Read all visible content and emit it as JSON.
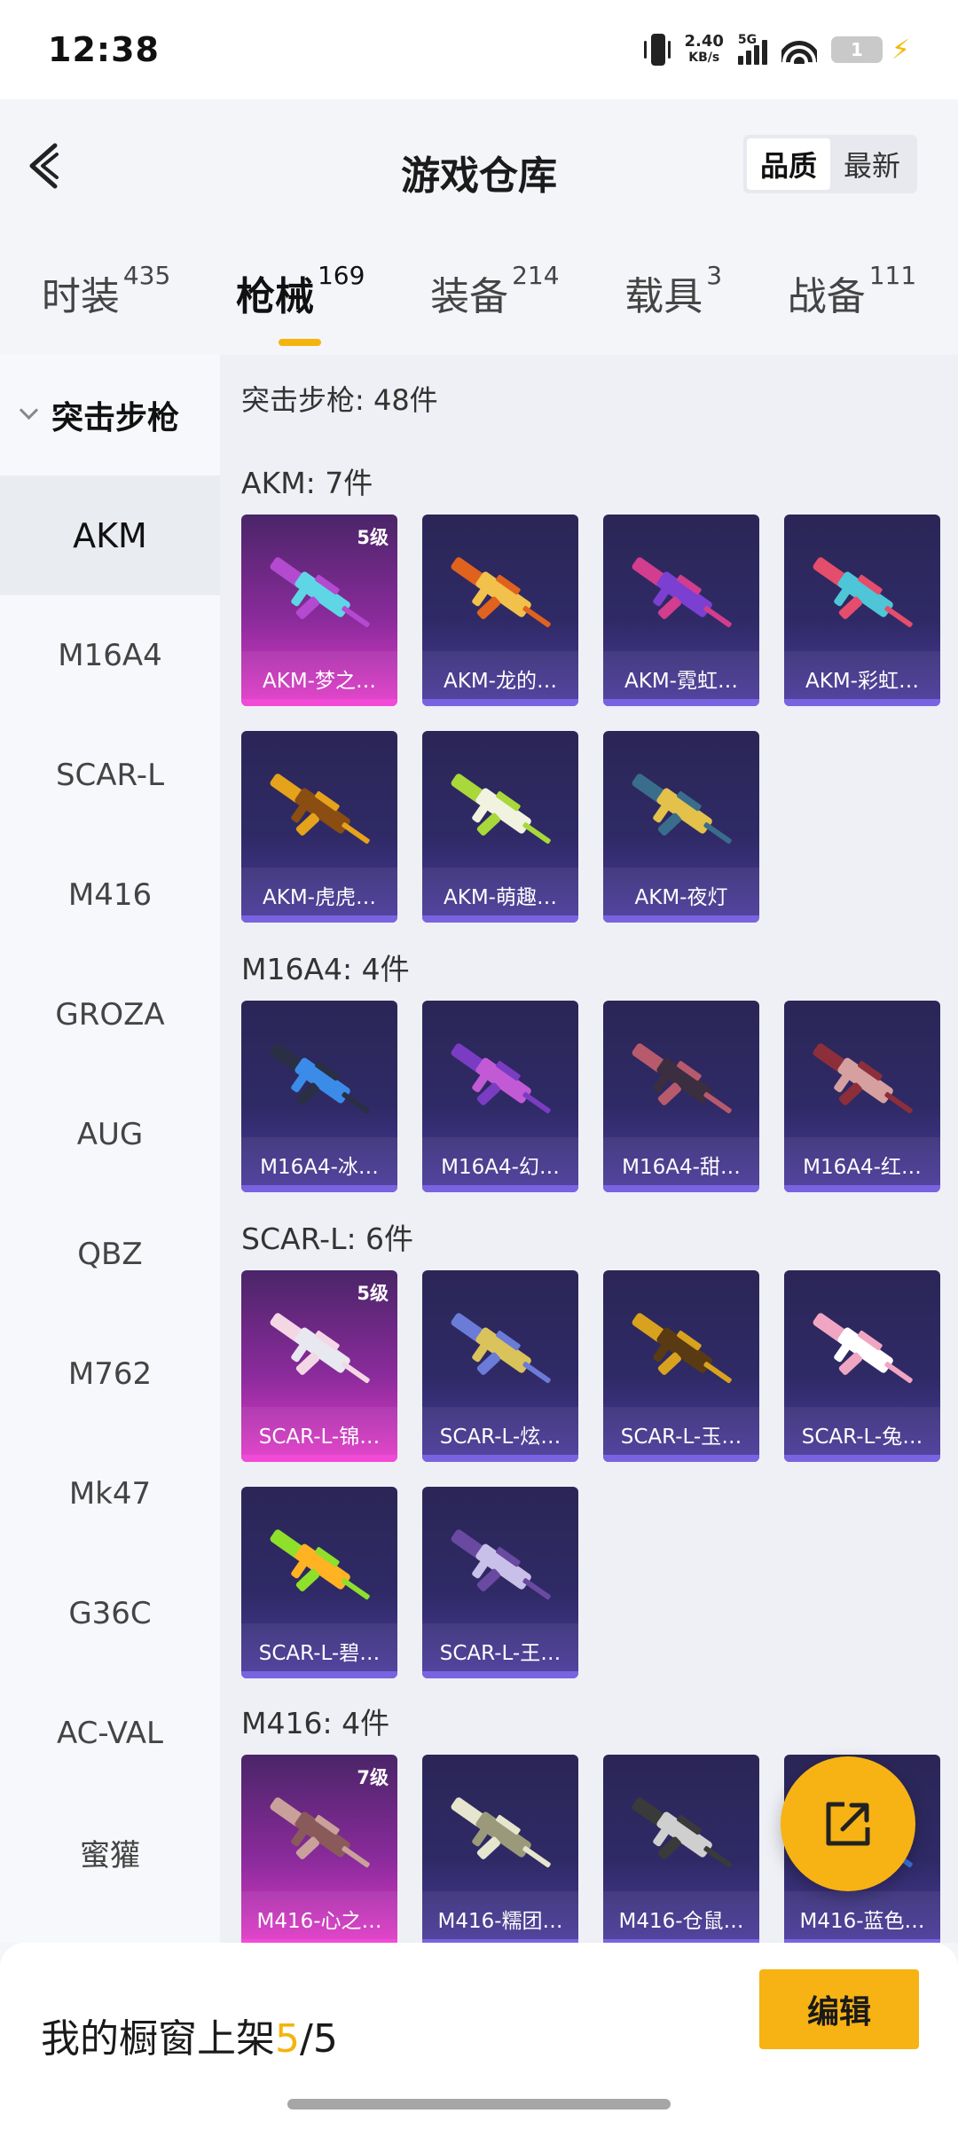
{
  "status": {
    "time": "12:38",
    "speed": "2.40",
    "speed_unit": "KB/s",
    "network": "5G",
    "battery": "1"
  },
  "header": {
    "title": "游戏仓库",
    "sort_options": [
      "品质",
      "最新"
    ],
    "sort_active": "品质"
  },
  "tabs": [
    {
      "label": "时装",
      "count": "435"
    },
    {
      "label": "枪械",
      "count": "169",
      "active": true
    },
    {
      "label": "装备",
      "count": "214"
    },
    {
      "label": "载具",
      "count": "3"
    },
    {
      "label": "战备",
      "count": "111"
    }
  ],
  "sidebar": {
    "section": "突击步枪",
    "items": [
      "AKM",
      "M16A4",
      "SCAR-L",
      "M416",
      "GROZA",
      "AUG",
      "QBZ",
      "M762",
      "Mk47",
      "G36C",
      "AC-VAL",
      "蜜獾"
    ],
    "active": "AKM"
  },
  "content": {
    "total": "突击步枪: 48件",
    "groups": [
      {
        "title": "AKM: 7件",
        "items": [
          {
            "label": "AKM-梦之…",
            "level": "5级",
            "rarity": "purple",
            "colors": [
              "#b44ad0",
              "#5ed6e6"
            ]
          },
          {
            "label": "AKM-龙的…",
            "rarity": "blue",
            "colors": [
              "#e0621f",
              "#f2c14b"
            ]
          },
          {
            "label": "AKM-霓虹…",
            "rarity": "blue",
            "colors": [
              "#d23d8e",
              "#7b3fd1"
            ]
          },
          {
            "label": "AKM-彩虹…",
            "rarity": "blue",
            "colors": [
              "#e44d6c",
              "#4ec6d8"
            ]
          },
          {
            "label": "AKM-虎虎…",
            "rarity": "blue",
            "colors": [
              "#e5a21b",
              "#8a4d12"
            ]
          },
          {
            "label": "AKM-萌趣…",
            "rarity": "blue",
            "colors": [
              "#a8d83a",
              "#f2f2e0"
            ]
          },
          {
            "label": "AKM-夜灯",
            "rarity": "blue",
            "colors": [
              "#3a6d8c",
              "#e3c14a"
            ]
          }
        ]
      },
      {
        "title": "M16A4: 4件",
        "items": [
          {
            "label": "M16A4-冰…",
            "rarity": "blue",
            "colors": [
              "#2a2f45",
              "#3b8be8"
            ]
          },
          {
            "label": "M16A4-幻…",
            "rarity": "blue",
            "colors": [
              "#7a3cc2",
              "#c25ad6"
            ]
          },
          {
            "label": "M16A4-甜…",
            "rarity": "blue",
            "colors": [
              "#b75a6c",
              "#3a2e40"
            ]
          },
          {
            "label": "M16A4-红…",
            "rarity": "blue",
            "colors": [
              "#8c2f3a",
              "#d6a0a0"
            ]
          }
        ]
      },
      {
        "title": "SCAR-L: 6件",
        "items": [
          {
            "label": "SCAR-L-锦…",
            "level": "5级",
            "rarity": "purple",
            "colors": [
              "#f4d7e4",
              "#e8e8f0"
            ]
          },
          {
            "label": "SCAR-L-炫…",
            "rarity": "blue",
            "colors": [
              "#6b7bd8",
              "#d9c35a"
            ]
          },
          {
            "label": "SCAR-L-玉…",
            "rarity": "blue",
            "colors": [
              "#d8a21e",
              "#5a3a12"
            ]
          },
          {
            "label": "SCAR-L-兔…",
            "rarity": "blue",
            "colors": [
              "#f0a6c2",
              "#ffffff"
            ]
          },
          {
            "label": "SCAR-L-碧…",
            "rarity": "blue",
            "colors": [
              "#8ee02a",
              "#ffb323"
            ]
          },
          {
            "label": "SCAR-L-王…",
            "rarity": "blue",
            "colors": [
              "#6a4aa0",
              "#c8c0e8"
            ]
          }
        ]
      },
      {
        "title": "M416: 4件",
        "items": [
          {
            "label": "M416-心之…",
            "level": "7级",
            "rarity": "purple",
            "colors": [
              "#c9a19a",
              "#8a5a5a"
            ]
          },
          {
            "label": "M416-糯团…",
            "rarity": "blue",
            "colors": [
              "#e6e6cf",
              "#9a9a7a"
            ]
          },
          {
            "label": "M416-仓鼠…",
            "rarity": "blue",
            "colors": [
              "#3a3a3a",
              "#cfcfcf"
            ]
          },
          {
            "label": "M416-蓝色…",
            "rarity": "blue",
            "colors": [
              "#3a6fd8",
              "#9ab7ef"
            ]
          }
        ]
      }
    ]
  },
  "bottom": {
    "text_prefix": "我的橱窗上架",
    "shown": "5",
    "separator": "/",
    "limit": "5",
    "edit_label": "编辑"
  }
}
